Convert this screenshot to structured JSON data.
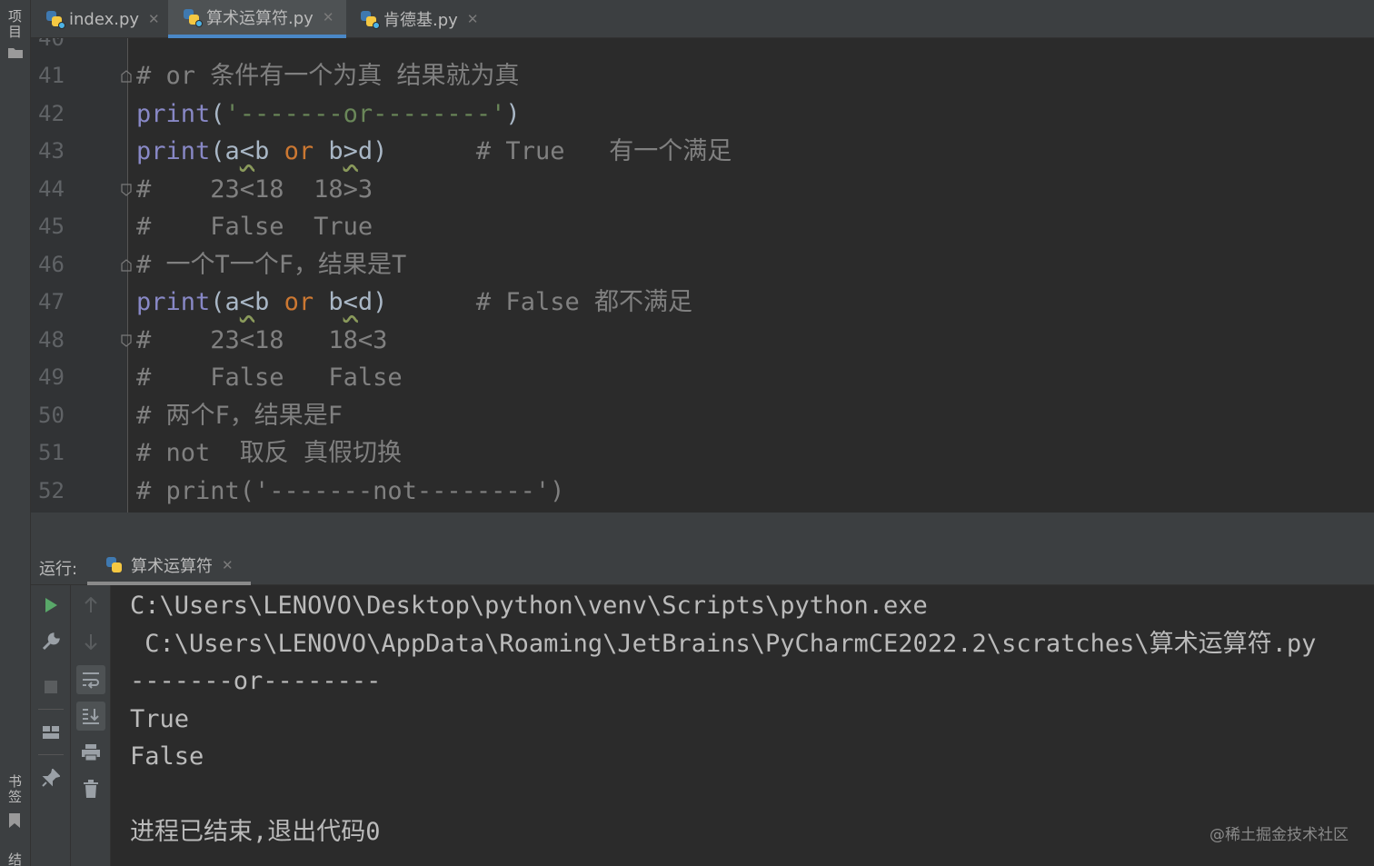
{
  "left_strip": {
    "project_label": "项目",
    "bookmarks_label": "书签",
    "structure_label": "结构",
    "icons": [
      "folder-icon",
      "bookmark-icon"
    ]
  },
  "tabs": [
    {
      "label": "index.py",
      "active": false,
      "icon": "python-file-icon"
    },
    {
      "label": "算术运算符.py",
      "active": true,
      "icon": "python-file-icon"
    },
    {
      "label": "肯德基.py",
      "active": false,
      "icon": "python-file-icon"
    }
  ],
  "editor": {
    "top_partial_line": "40",
    "lines": [
      {
        "num": "41",
        "text": "# or 条件有一个为真 结果就为真"
      },
      {
        "num": "42",
        "text": "print('-------or--------')"
      },
      {
        "num": "43",
        "text": "print(a<b or b>d)      # True   有一个满足"
      },
      {
        "num": "44",
        "text": "#    23<18  18>3"
      },
      {
        "num": "45",
        "text": "#    False  True"
      },
      {
        "num": "46",
        "text": "# 一个T一个F，结果是T"
      },
      {
        "num": "47",
        "text": "print(a<b or b<d)      # False 都不满足"
      },
      {
        "num": "48",
        "text": "#    23<18   18<3"
      },
      {
        "num": "49",
        "text": "#    False   False"
      },
      {
        "num": "50",
        "text": "# 两个F，结果是F"
      },
      {
        "num": "51",
        "text": "# not  取反 真假切换"
      },
      {
        "num": "52",
        "text": "# print('-------not--------')"
      }
    ],
    "colors": {
      "function": "#8888c6",
      "keyword": "#cc7832",
      "string": "#6a8759",
      "comment": "#808080"
    }
  },
  "run_panel": {
    "label": "运行:",
    "tab_label": "算术运算符",
    "toolbar_icons": [
      "run-icon",
      "wrench-icon",
      "stop-icon",
      "layout-icon",
      "pin-icon",
      "up-arrow-icon",
      "down-arrow-icon",
      "soft-wrap-icon",
      "scroll-to-end-icon",
      "print-icon",
      "trash-icon"
    ],
    "console_lines": [
      "C:\\Users\\LENOVO\\Desktop\\python\\venv\\Scripts\\python.exe",
      " C:\\Users\\LENOVO\\AppData\\Roaming\\JetBrains\\PyCharmCE2022.2\\scratches\\算术运算符.py",
      "-------or--------",
      "True",
      "False",
      "",
      "进程已结束,退出代码0"
    ],
    "watermark": "@稀土掘金技术社区"
  }
}
